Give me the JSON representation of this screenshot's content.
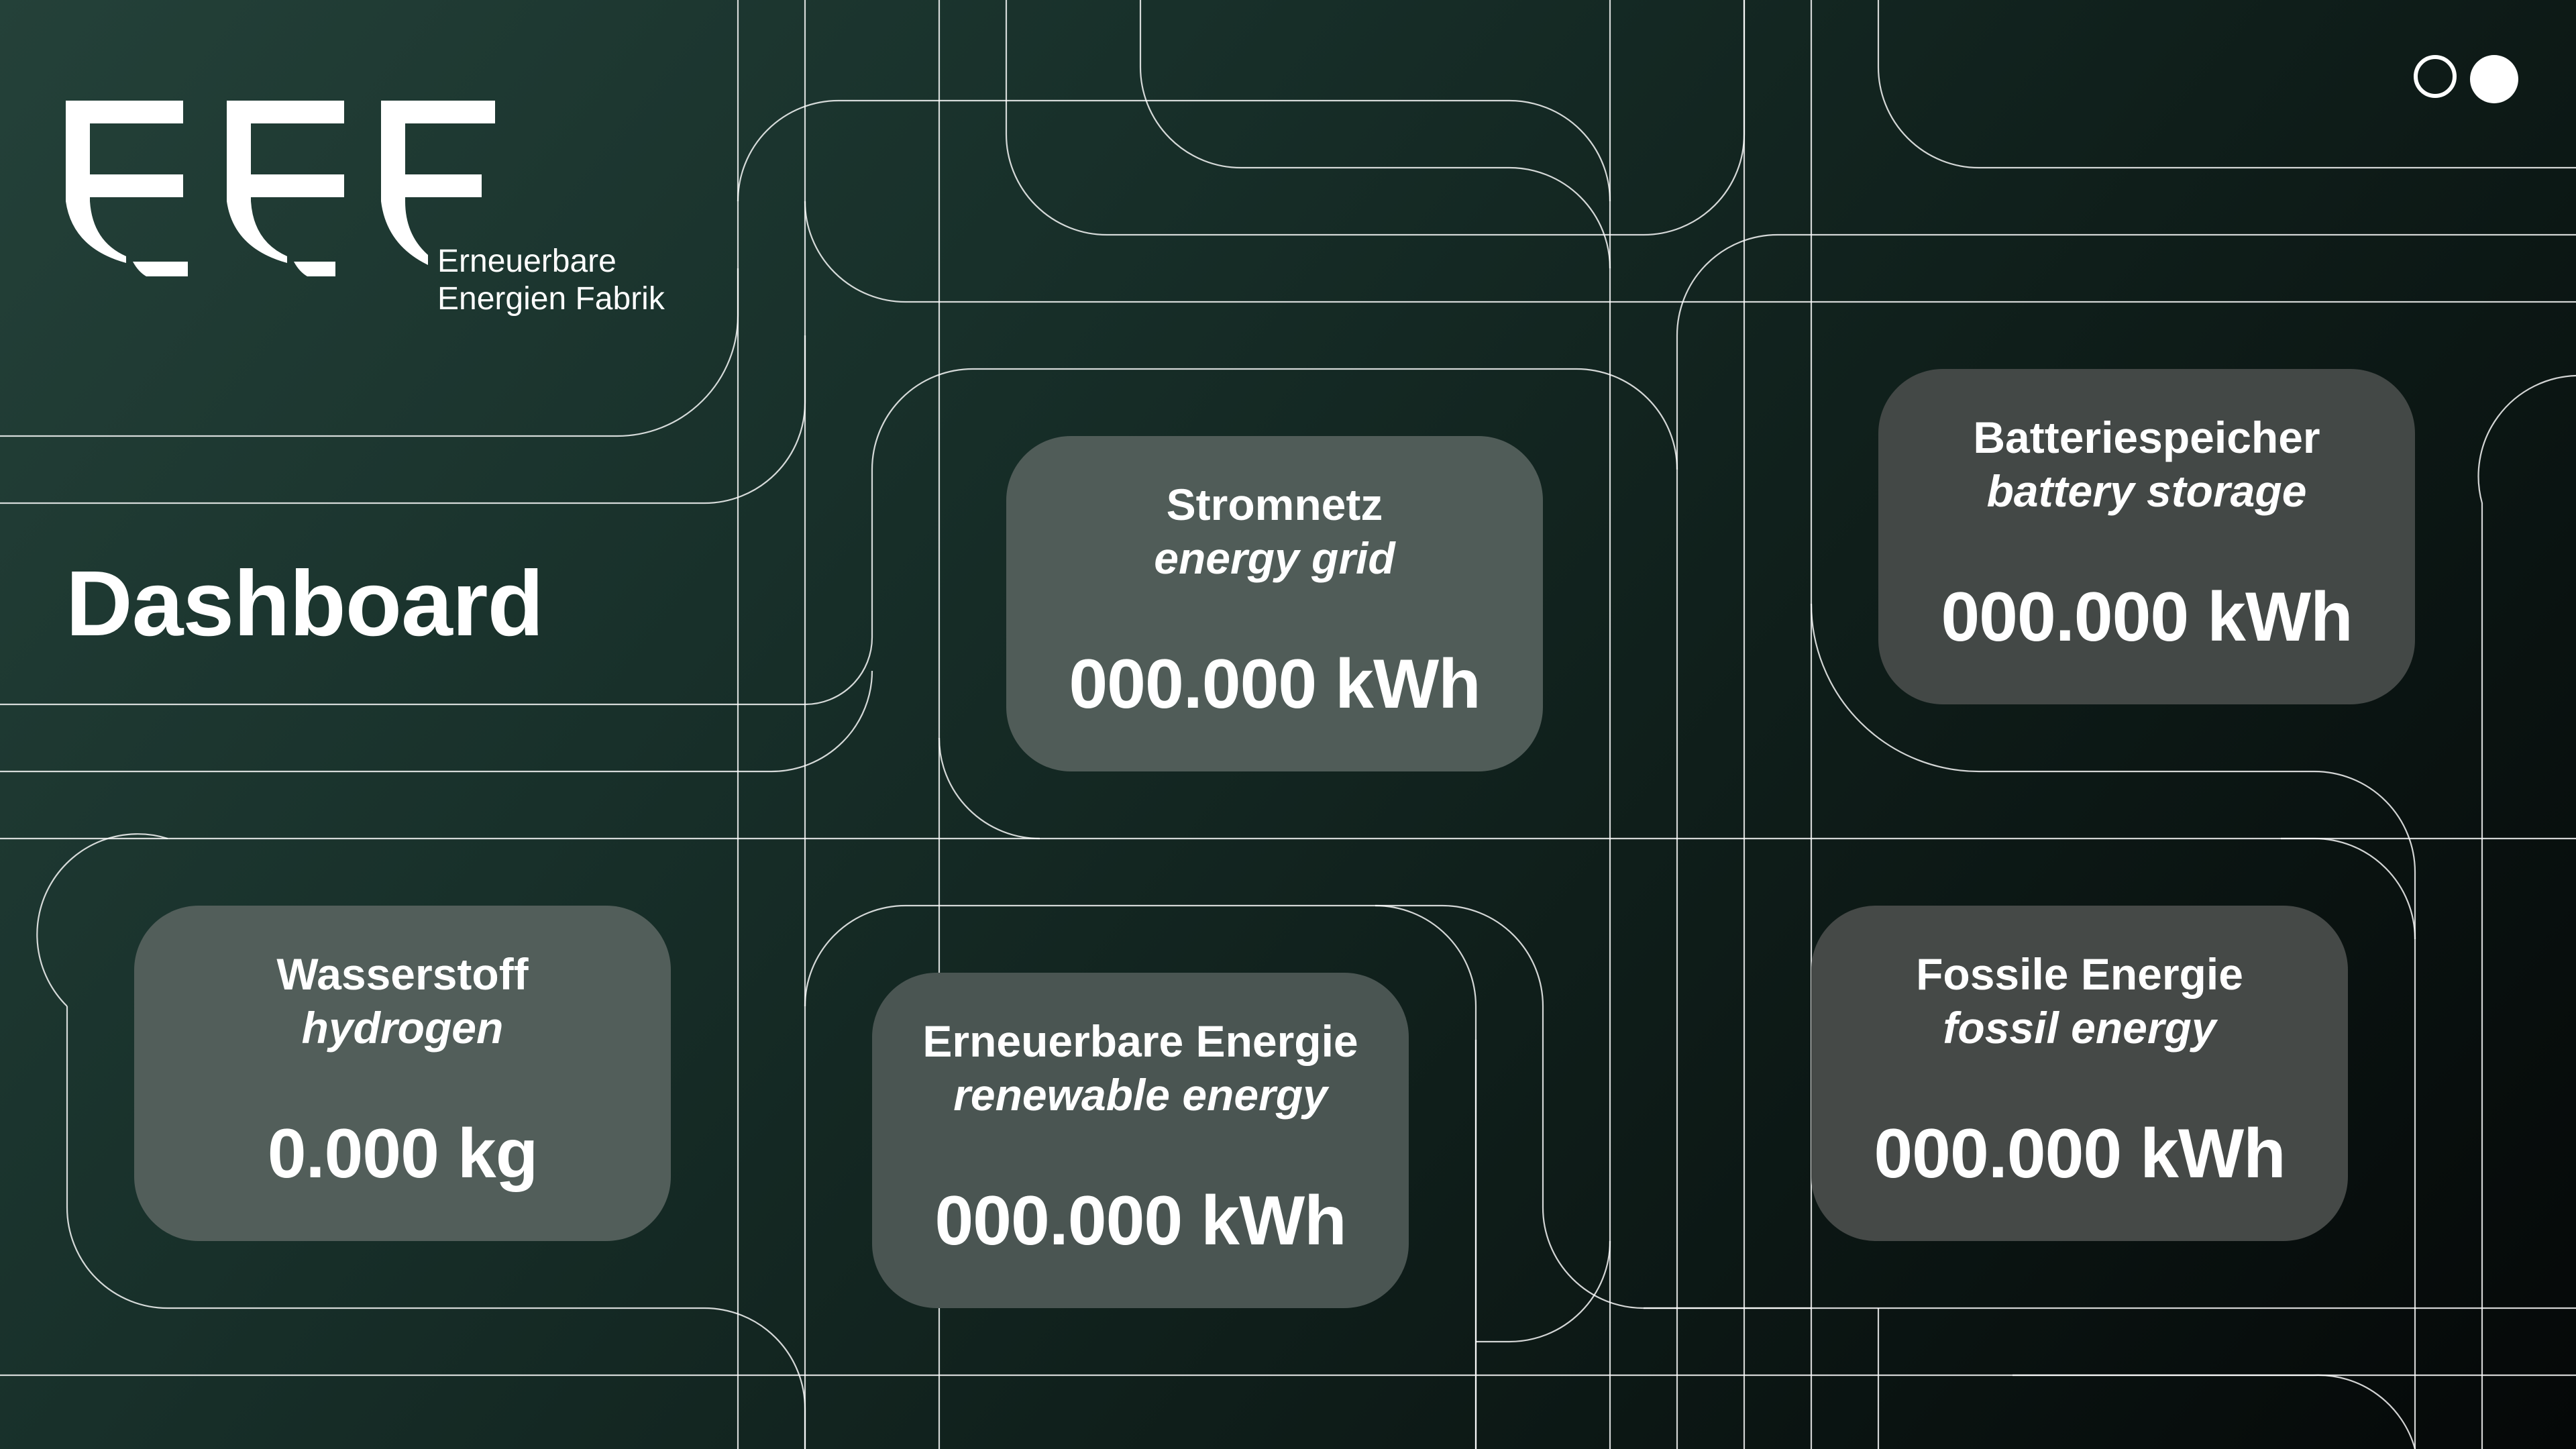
{
  "brand": {
    "logo_letters": "EEF",
    "subtitle_line1": "Erneuerbare",
    "subtitle_line2": "Energien Fabrik"
  },
  "page": {
    "title": "Dashboard"
  },
  "theme_toggle": {
    "icon": "theme-toggle-icon"
  },
  "colors": {
    "background_start": "#244139",
    "background_end": "#050808",
    "card": "#505c58",
    "text": "#ffffff"
  },
  "cards": [
    {
      "id": "grid",
      "title_de": "Stromnetz",
      "title_en": "energy grid",
      "value": "000.000 kWh"
    },
    {
      "id": "battery",
      "title_de": "Batteriespeicher",
      "title_en": "battery storage",
      "value": "000.000 kWh"
    },
    {
      "id": "hydrogen",
      "title_de": "Wasserstoff",
      "title_en": "hydrogen",
      "value": "0.000 kg"
    },
    {
      "id": "renewable",
      "title_de": "Erneuerbare Energie",
      "title_en": "renewable energy",
      "value": "000.000 kWh"
    },
    {
      "id": "fossil",
      "title_de": "Fossile Energie",
      "title_en": "fossil energy",
      "value": "000.000 kWh"
    }
  ]
}
